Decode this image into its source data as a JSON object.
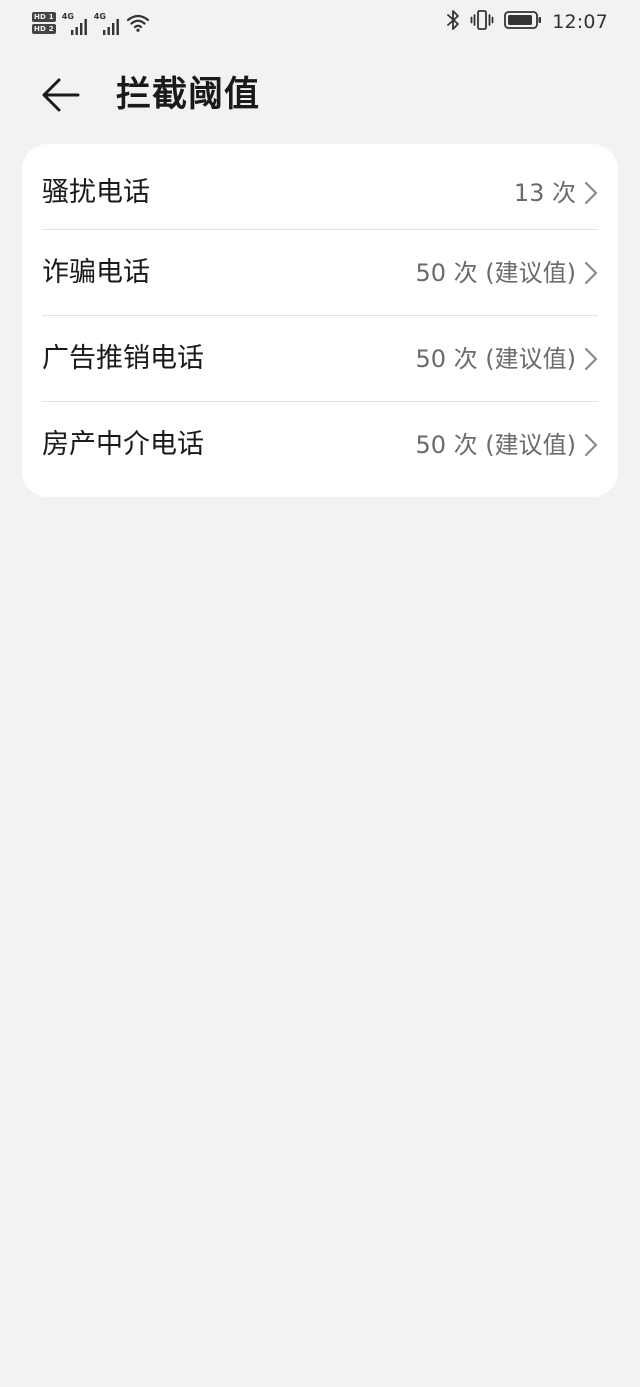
{
  "status_bar": {
    "hd1": "HD 1",
    "hd2": "HD 2",
    "network1": "4G",
    "network2": "4G",
    "time": "12:07"
  },
  "header": {
    "title": "拦截阈值",
    "back_icon": "arrow-left-icon"
  },
  "threshold_list": [
    {
      "label": "骚扰电话",
      "value": "13 次"
    },
    {
      "label": "诈骗电话",
      "value": "50 次 (建议值)"
    },
    {
      "label": "广告推销电话",
      "value": "50 次 (建议值)"
    },
    {
      "label": "房产中介电话",
      "value": "50 次 (建议值)"
    }
  ],
  "colors": {
    "background": "#f1f2f4",
    "card": "#ffffff",
    "value_text": "#6b6b6b"
  }
}
